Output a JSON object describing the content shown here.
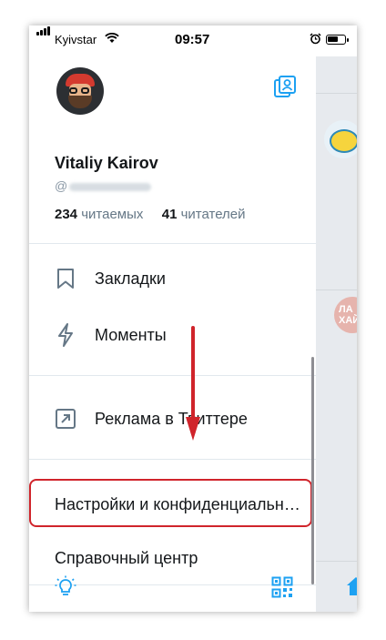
{
  "status_bar": {
    "carrier": "Kyivstar",
    "time": "09:57",
    "battery_level": 0.65
  },
  "profile": {
    "display_name": "Vitaliy Kairov",
    "handle_prefix": "@",
    "following_count": "234",
    "following_label": "читаемых",
    "followers_count": "41",
    "followers_label": "читателей"
  },
  "menu": {
    "bookmarks": "Закладки",
    "moments": "Моменты",
    "twitter_ads": "Реклама в Твиттере",
    "settings_privacy": "Настройки и конфиденциальн…",
    "help_center": "Справочный центр"
  },
  "background_timeline": {
    "avatar_text": "ЛА ХАЙ"
  },
  "colors": {
    "accent": "#1da1f2",
    "highlight_border": "#d0242b",
    "arrow": "#d0242b",
    "text_primary": "#14171a",
    "text_secondary": "#657786"
  },
  "icons": {
    "account_switch": "account-switch-icon",
    "bookmark": "bookmark-icon",
    "moments": "lightning-icon",
    "ads": "external-link-arrow-icon",
    "bulb": "lightbulb-icon",
    "qr": "qr-code-icon"
  }
}
